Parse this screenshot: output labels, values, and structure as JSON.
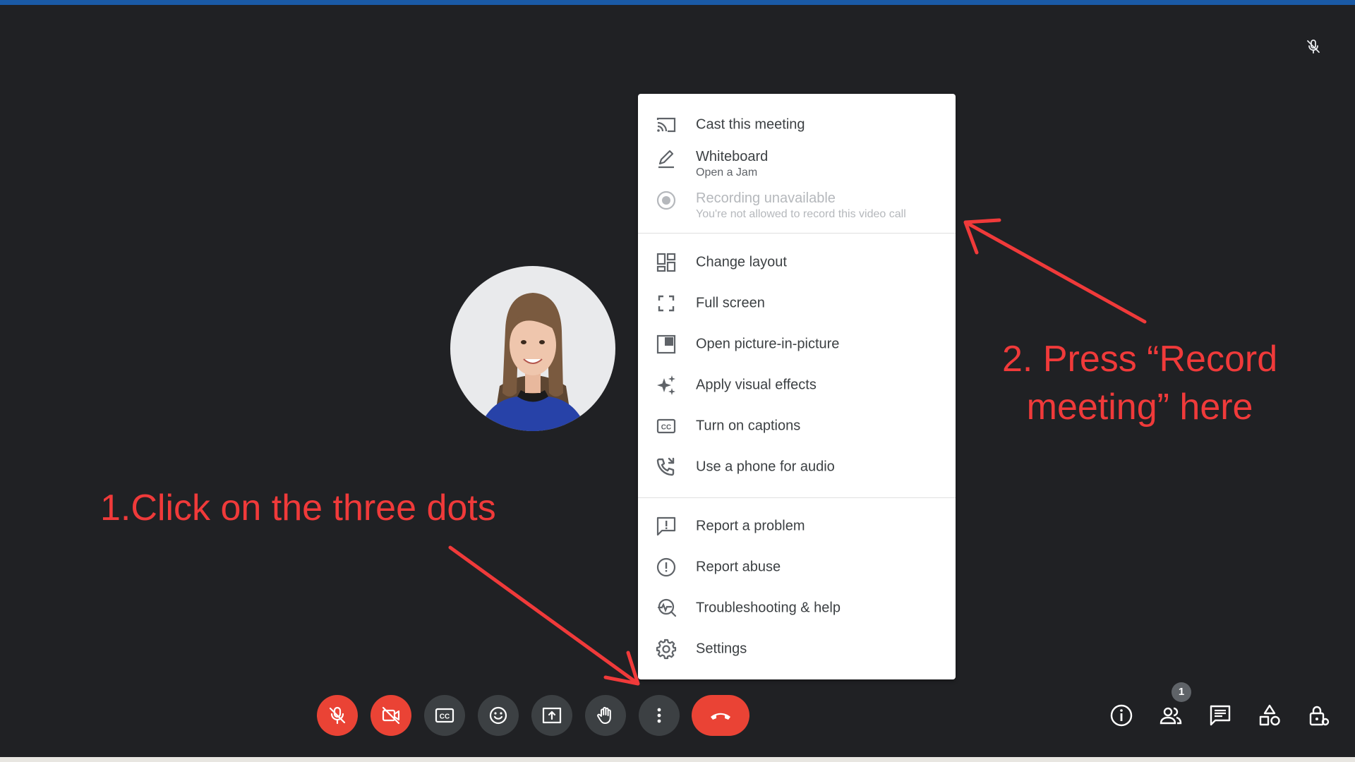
{
  "menu": {
    "items": [
      {
        "label": "Cast this meeting",
        "icon": "cast-icon"
      },
      {
        "label": "Whiteboard",
        "sub": "Open a Jam",
        "icon": "pencil-icon"
      },
      {
        "label": "Recording unavailable",
        "sub": "You're not allowed to record this video call",
        "icon": "record-icon",
        "disabled": true
      },
      {
        "label": "Change layout",
        "icon": "layout-icon"
      },
      {
        "label": "Full screen",
        "icon": "fullscreen-icon"
      },
      {
        "label": "Open picture-in-picture",
        "icon": "pip-icon"
      },
      {
        "label": "Apply visual effects",
        "icon": "sparkle-icon"
      },
      {
        "label": "Turn on captions",
        "icon": "captions-icon"
      },
      {
        "label": "Use a phone for audio",
        "icon": "phone-icon"
      },
      {
        "label": "Report a problem",
        "icon": "feedback-icon"
      },
      {
        "label": "Report abuse",
        "icon": "alert-icon"
      },
      {
        "label": "Troubleshooting & help",
        "icon": "troubleshoot-icon"
      },
      {
        "label": "Settings",
        "icon": "gear-icon"
      }
    ]
  },
  "annotations": {
    "step1": "1.Click on the three dots",
    "step2_line1": "2. Press “Record",
    "step2_line2": "meeting” here",
    "color": "#f03a3a"
  },
  "controls": {
    "participant_count": "1",
    "accent_red": "#ea4335",
    "button_gray": "#3c4043"
  }
}
